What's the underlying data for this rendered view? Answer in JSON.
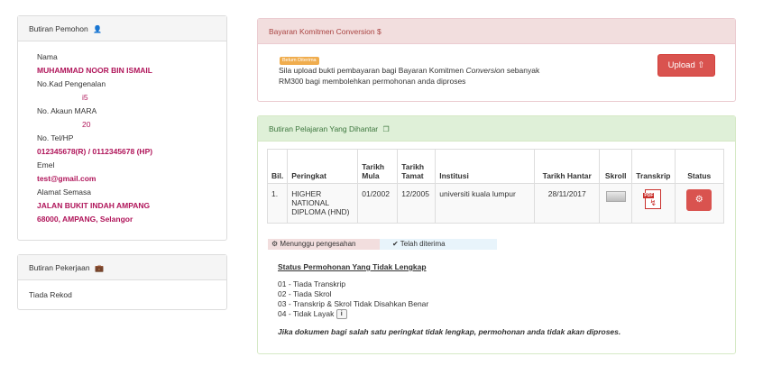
{
  "pemohon": {
    "title": "Butiran Pemohon",
    "icon": "user-icon",
    "fields": [
      {
        "label": "Nama",
        "value": "MUHAMMAD NOOR BIN ISMAIL"
      },
      {
        "label": "No.Kad Pengenalan",
        "value": "i5"
      },
      {
        "label": "No. Akaun MARA",
        "value": "20"
      },
      {
        "label": "No. Tel/HP",
        "value": "012345678(R) / 0112345678 (HP)"
      },
      {
        "label": "Emel",
        "value": "test@gmail.com"
      },
      {
        "label": "Alamat Semasa",
        "value": "JALAN BUKIT INDAH AMPANG"
      },
      {
        "label": "",
        "value": "68000, AMPANG, Selangor"
      }
    ]
  },
  "pekerjaan": {
    "title": "Butiran Pekerjaan",
    "icon": "briefcase-icon",
    "body": "Tiada Rekod"
  },
  "bayaran": {
    "title": "Bayaran Komitmen Conversion $",
    "badge": "Belum Diterima",
    "text_line1": "Sila upload bukti pembayaran bagi Bayaran Komitmen",
    "text_line1_em": "Conversion",
    "text_line1_end": "sebanyak",
    "text_line2": "RM300 bagi membolehkan permohonan anda diproses",
    "upload_label": "Upload",
    "upload_icon": "upload-circle-icon"
  },
  "pelajaran": {
    "title": "Butiran Pelajaran Yang Dihantar",
    "icon": "copy-icon",
    "columns": [
      "Bil.",
      "Peringkat",
      "Tarikh Mula",
      "Tarikh Tamat",
      "Institusi",
      "Tarikh Hantar",
      "Skroll",
      "Transkrip",
      "Status"
    ],
    "rows": [
      {
        "bil": "1.",
        "peringkat": "HIGHER NATIONAL DIPLOMA (HND)",
        "mula": "01/2002",
        "tamat": "12/2005",
        "institusi": "universiti kuala lumpur",
        "hantar": "28/11/2017",
        "transkrip_icon": "pdf-icon",
        "status_icon": "gears-icon"
      }
    ],
    "legend": {
      "pending": "Menunggu pengesahan",
      "pending_icon": "gears-icon",
      "accepted": "Telah diterima",
      "accepted_icon": "check-icon"
    },
    "status_title": "Status Permohonan Yang Tidak Lengkap",
    "status_items": [
      "01 - Tiada Transkrip",
      "02 - Tiada Skrol",
      "03 - Transkrip & Skrol Tidak Disahkan Benar",
      "04 - Tidak Layak"
    ],
    "note": "Jika dokumen bagi salah satu peringkat tidak lengkap, permohonan anda tidak akan diproses."
  },
  "colors": {
    "danger": "#d9534f",
    "danger_bg": "#f2dede",
    "success_bg": "#dff0d8",
    "highlight_text": "#b0155a"
  }
}
